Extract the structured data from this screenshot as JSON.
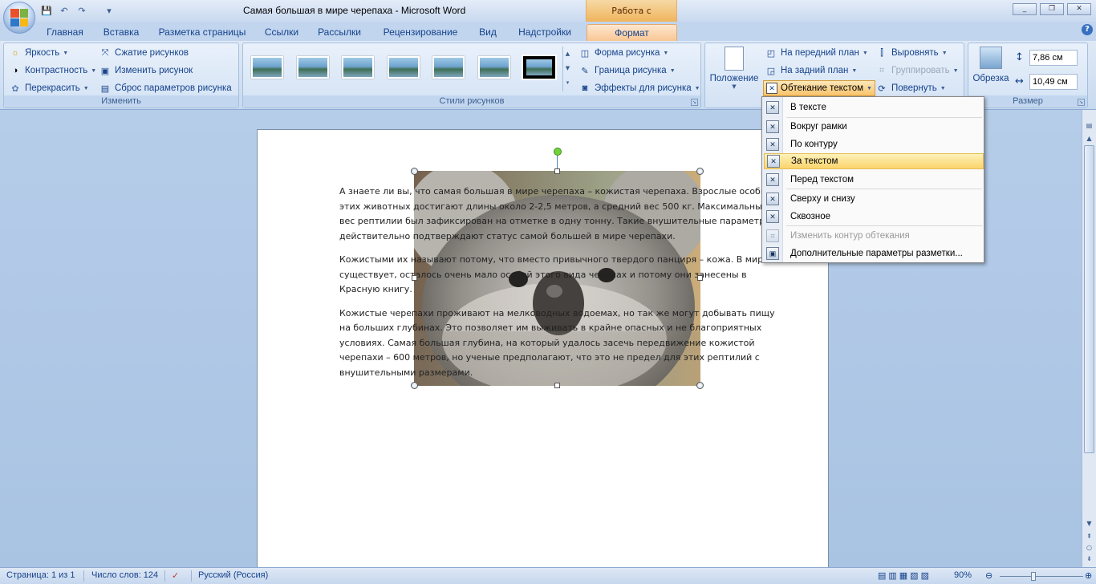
{
  "window": {
    "title": "Самая большая в мире черепаха - Microsoft Word",
    "contextual_header": "Работа с рисунками",
    "controls": [
      "_",
      "❐",
      "✕"
    ]
  },
  "qat": {
    "save": "💾",
    "undo": "↶",
    "redo": "↷",
    "customize": "▾"
  },
  "tabs": [
    {
      "label": "Главная"
    },
    {
      "label": "Вставка"
    },
    {
      "label": "Разметка страницы"
    },
    {
      "label": "Ссылки"
    },
    {
      "label": "Рассылки"
    },
    {
      "label": "Рецензирование"
    },
    {
      "label": "Вид"
    },
    {
      "label": "Надстройки"
    },
    {
      "label": "Формат",
      "active": true
    }
  ],
  "ribbon": {
    "adjust": {
      "label": "Изменить",
      "brightness": "Яркость",
      "contrast": "Контрастность",
      "recolor": "Перекрасить",
      "compress": "Сжатие рисунков",
      "change": "Изменить рисунок",
      "reset": "Сброс параметров рисунка"
    },
    "styles": {
      "label": "Стили рисунков",
      "shape": "Форма рисунка",
      "border": "Граница рисунка",
      "effects": "Эффекты для рисунка",
      "thumb_count": 7,
      "selected_index": 6
    },
    "arrange": {
      "position": "Положение",
      "front": "На передний план",
      "back": "На задний план",
      "wrap": "Обтекание текстом",
      "align": "Выровнять",
      "group": "Группировать",
      "rotate": "Повернуть"
    },
    "size": {
      "label": "Размер",
      "crop": "Обрезка",
      "height": "7,86 см",
      "width": "10,49 см"
    }
  },
  "wrap_menu": {
    "items": [
      {
        "label": "В тексте"
      },
      {
        "label": "Вокруг рамки"
      },
      {
        "label": "По контуру"
      },
      {
        "label": "За текстом",
        "highlighted": true
      },
      {
        "label": "Перед текстом"
      },
      {
        "label": "Сверху и снизу"
      },
      {
        "label": "Сквозное"
      },
      {
        "label": "Изменить контур обтекания",
        "disabled": true
      },
      {
        "label": "Дополнительные параметры разметки..."
      }
    ]
  },
  "document": {
    "paragraphs": [
      "А знаете ли вы, что самая большая в мире черепаха – кожистая черепаха. Взрослые особи этих животных достигают длины около 2-2,5 метров, а средний вес 500 кг. Максимальный вес рептилии был зафиксирован на отметке в одну тонну. Такие внушительные параметры действительно подтверждают статус самой большей в мире черепахи.",
      "Кожистыми их называют потому, что вместо привычного твердого панциря – кожа. В мире существует, осталось очень мало особей этого вида черепах и потому они занесены в Красную книгу.",
      "Кожистые черепахи проживают на мелководных водоемах, но так же могут добывать пищу на больших глубинах. Это позволяет им выживать в крайне опасных и не благоприятных условиях. Самая большая глубина, на который удалось засечь передвижение кожистой черепахи – 600 метров, но ученые предполагают, что это не предел для этих рептилий с внушительными размерами."
    ]
  },
  "statusbar": {
    "page": "Страница: 1 из 1",
    "words": "Число слов: 124",
    "language": "Русский (Россия)",
    "zoom": "90%"
  }
}
